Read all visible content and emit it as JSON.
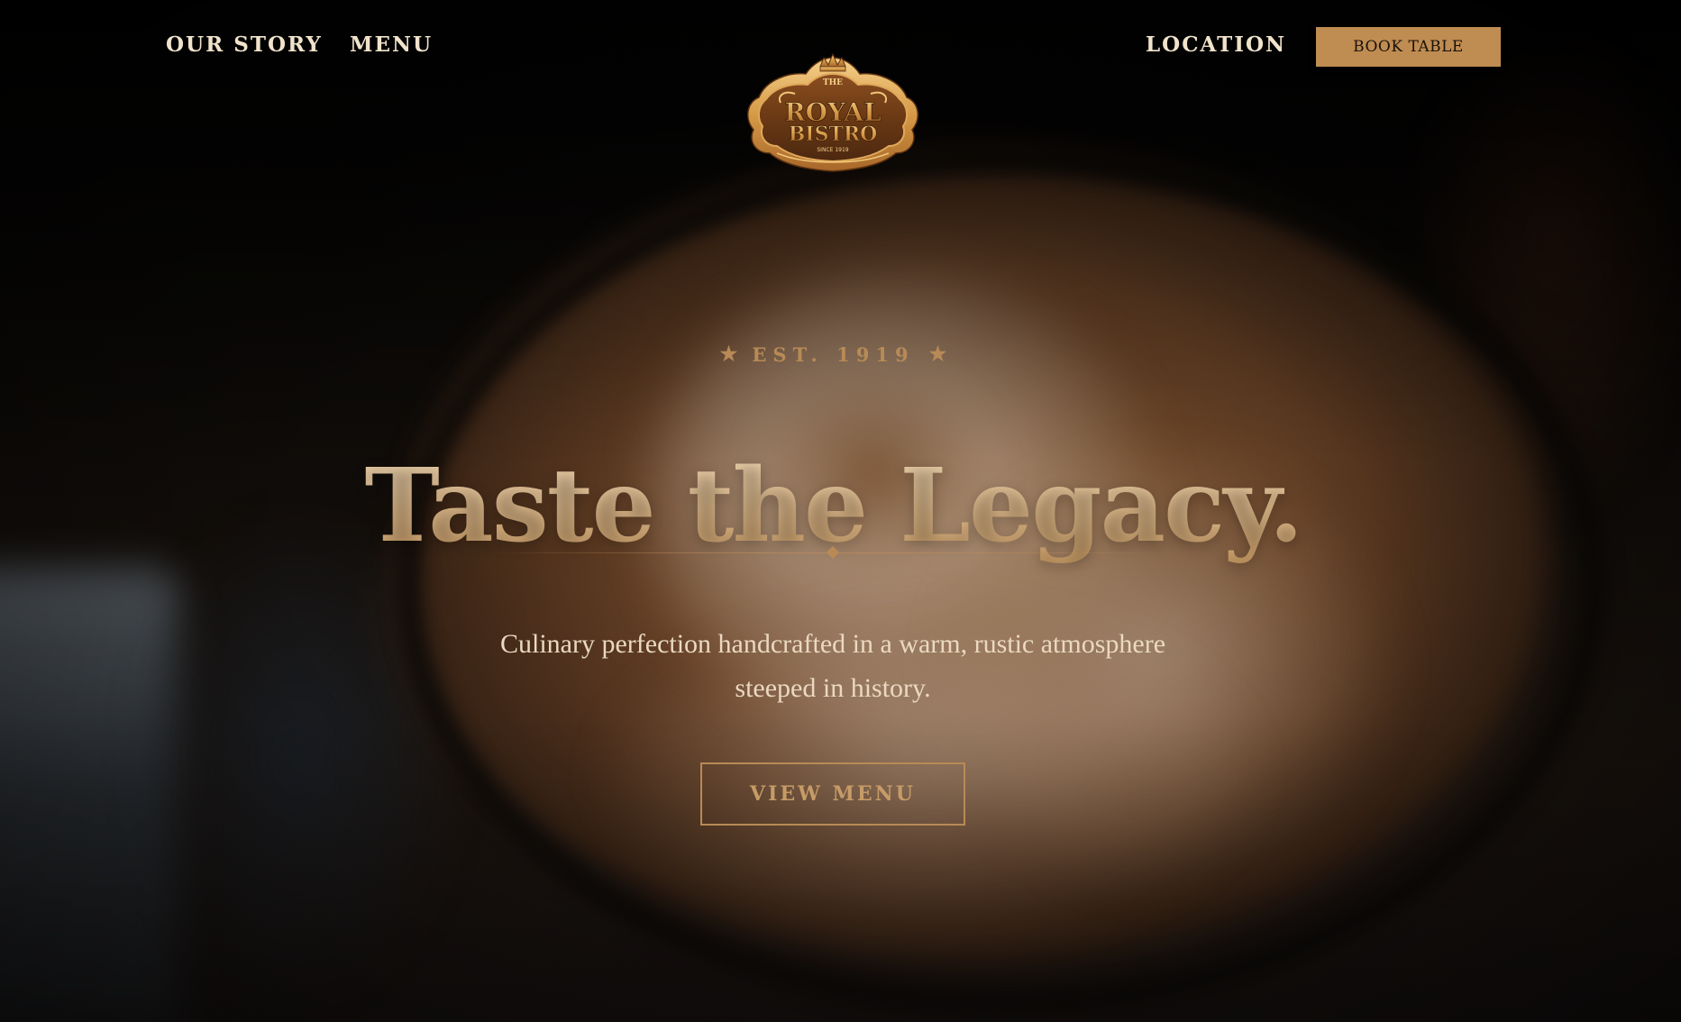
{
  "nav": {
    "left_links": [
      {
        "label": "OUR STORY"
      },
      {
        "label": "MENU"
      }
    ],
    "right_link": {
      "label": "LOCATION"
    },
    "book_button": {
      "label": "BOOK TABLE"
    }
  },
  "logo": {
    "top_word": "THE",
    "line1": "ROYAL",
    "line2": "BISTRO",
    "since": "SINCE 1919"
  },
  "hero": {
    "est_label": "EST. 1919",
    "est_icon": "star-icon",
    "headline": "Taste the Legacy.",
    "subtitle_line1": "Culinary perfection handcrafted in a warm, rustic atmosphere",
    "subtitle_line2": "steeped in history.",
    "cta_label": "VIEW MENU"
  },
  "colors": {
    "accent": "#bf8c52",
    "nav_text": "#f1e3cb",
    "gold_text": "#b88a56",
    "background": "#0b0908"
  }
}
